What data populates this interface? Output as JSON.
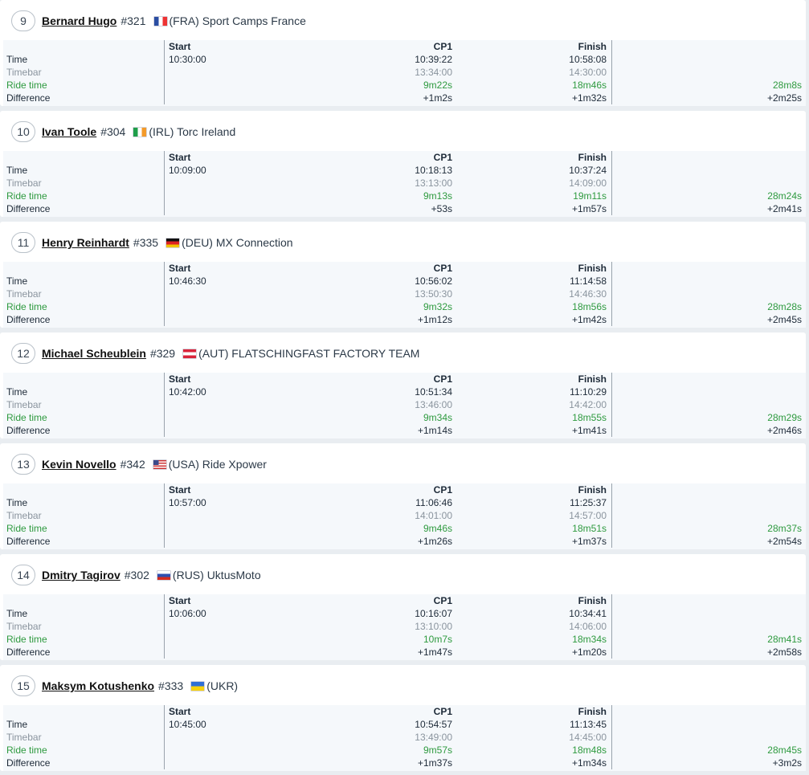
{
  "labels": {
    "start": "Start",
    "cp1": "CP1",
    "finish": "Finish",
    "time": "Time",
    "timebar": "Timebar",
    "ride_time": "Ride time",
    "difference": "Difference"
  },
  "colors": {
    "accent_green": "#2e9a3f",
    "muted_gray": "#8a949e"
  },
  "riders": [
    {
      "rank": "9",
      "name": "Bernard Hugo",
      "number": "#321",
      "flag": "FRA",
      "team": "(FRA) Sport Camps France",
      "start": "10:30:00",
      "cp1": {
        "time": "10:39:22",
        "timebar": "13:34:00",
        "ride": "9m22s",
        "diff": "+1m2s"
      },
      "finish": {
        "time": "10:58:08",
        "timebar": "14:30:00",
        "ride": "18m46s",
        "diff": "+1m32s"
      },
      "total": {
        "ride": "28m8s",
        "diff": "+2m25s"
      }
    },
    {
      "rank": "10",
      "name": "Ivan Toole",
      "number": "#304",
      "flag": "IRL",
      "team": "(IRL) Torc Ireland",
      "start": "10:09:00",
      "cp1": {
        "time": "10:18:13",
        "timebar": "13:13:00",
        "ride": "9m13s",
        "diff": "+53s"
      },
      "finish": {
        "time": "10:37:24",
        "timebar": "14:09:00",
        "ride": "19m11s",
        "diff": "+1m57s"
      },
      "total": {
        "ride": "28m24s",
        "diff": "+2m41s"
      }
    },
    {
      "rank": "11",
      "name": "Henry Reinhardt",
      "number": "#335",
      "flag": "DEU",
      "team": "(DEU) MX Connection",
      "start": "10:46:30",
      "cp1": {
        "time": "10:56:02",
        "timebar": "13:50:30",
        "ride": "9m32s",
        "diff": "+1m12s"
      },
      "finish": {
        "time": "11:14:58",
        "timebar": "14:46:30",
        "ride": "18m56s",
        "diff": "+1m42s"
      },
      "total": {
        "ride": "28m28s",
        "diff": "+2m45s"
      }
    },
    {
      "rank": "12",
      "name": "Michael Scheublein",
      "number": "#329",
      "flag": "AUT",
      "team": "(AUT) FLATSCHINGFAST FACTORY TEAM",
      "start": "10:42:00",
      "cp1": {
        "time": "10:51:34",
        "timebar": "13:46:00",
        "ride": "9m34s",
        "diff": "+1m14s"
      },
      "finish": {
        "time": "11:10:29",
        "timebar": "14:42:00",
        "ride": "18m55s",
        "diff": "+1m41s"
      },
      "total": {
        "ride": "28m29s",
        "diff": "+2m46s"
      }
    },
    {
      "rank": "13",
      "name": "Kevin Novello",
      "number": "#342",
      "flag": "USA",
      "team": "(USA) Ride Xpower",
      "start": "10:57:00",
      "cp1": {
        "time": "11:06:46",
        "timebar": "14:01:00",
        "ride": "9m46s",
        "diff": "+1m26s"
      },
      "finish": {
        "time": "11:25:37",
        "timebar": "14:57:00",
        "ride": "18m51s",
        "diff": "+1m37s"
      },
      "total": {
        "ride": "28m37s",
        "diff": "+2m54s"
      }
    },
    {
      "rank": "14",
      "name": "Dmitry Tagirov",
      "number": "#302",
      "flag": "RUS",
      "team": "(RUS) UktusMoto",
      "start": "10:06:00",
      "cp1": {
        "time": "10:16:07",
        "timebar": "13:10:00",
        "ride": "10m7s",
        "diff": "+1m47s"
      },
      "finish": {
        "time": "10:34:41",
        "timebar": "14:06:00",
        "ride": "18m34s",
        "diff": "+1m20s"
      },
      "total": {
        "ride": "28m41s",
        "diff": "+2m58s"
      }
    },
    {
      "rank": "15",
      "name": "Maksym Kotushenko",
      "number": "#333",
      "flag": "UKR",
      "team": "(UKR)",
      "start": "10:45:00",
      "cp1": {
        "time": "10:54:57",
        "timebar": "13:49:00",
        "ride": "9m57s",
        "diff": "+1m37s"
      },
      "finish": {
        "time": "11:13:45",
        "timebar": "14:45:00",
        "ride": "18m48s",
        "diff": "+1m34s"
      },
      "total": {
        "ride": "28m45s",
        "diff": "+3m2s"
      }
    }
  ]
}
